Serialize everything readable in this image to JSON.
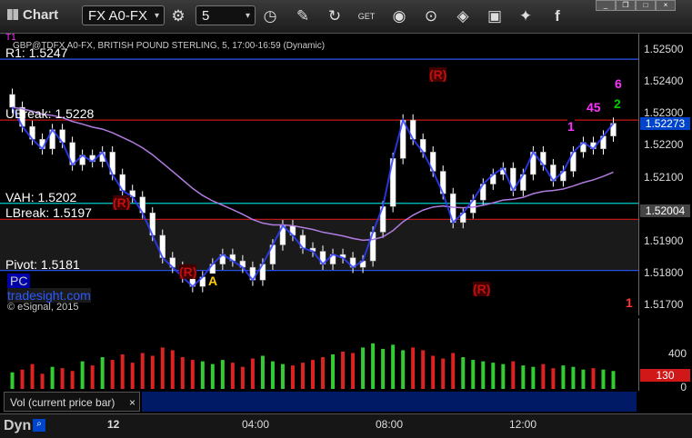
{
  "toolbar": {
    "title": "Chart",
    "symbol": "FX A0-FX",
    "interval": "5",
    "icons": [
      "clock-icon",
      "pencil-icon",
      "refresh-icon",
      "cursor-icon",
      "play-icon",
      "diamond-icon",
      "app-icon",
      "twitter-icon",
      "facebook-icon"
    ]
  },
  "chart": {
    "header": "GBP@TDFX A0-FX, BRITISH POUND STERLING, 5, 17:00-16:59 (Dynamic)",
    "corner_label": "T1",
    "copyright": "© eSignal, 2015",
    "watermark": "tradesight.com",
    "pc_label": "PC",
    "levels": [
      {
        "label": "R1: 1.5247",
        "value": 1.5247,
        "color": "#2d58ff"
      },
      {
        "label": "UBreak: 1.5228",
        "value": 1.5228,
        "color": "#d01818"
      },
      {
        "label": "VAH: 1.5202",
        "value": 1.5202,
        "color": "#00cccc"
      },
      {
        "label": "LBreak: 1.5197",
        "value": 1.5197,
        "color": "#d01818"
      },
      {
        "label": "Pivot: 1.5181",
        "value": 1.5181,
        "color": "#2d58ff"
      }
    ],
    "markers": [
      {
        "text": "(R)",
        "color": "#c01010",
        "bg": "#400000"
      },
      {
        "text": "(R)",
        "color": "#c01010",
        "bg": "#400000"
      },
      {
        "text": "(R)",
        "color": "#c01010",
        "bg": "#400000"
      },
      {
        "text": "(R)",
        "color": "#c01010",
        "bg": "#400000"
      },
      {
        "text": "A",
        "color": "#ffcc00",
        "bg": "#000"
      },
      {
        "text": "1",
        "color": "#ff3333",
        "bg": "#000"
      },
      {
        "text": "1",
        "color": "#ff33ff",
        "bg": "#000"
      },
      {
        "text": "6",
        "color": "#ff33ff",
        "bg": "#000"
      },
      {
        "text": "45",
        "color": "#ff33ff",
        "bg": "#000"
      },
      {
        "text": "2",
        "color": "#00cc00",
        "bg": "#000"
      }
    ],
    "price_axis": {
      "ticks": [
        "1.52500",
        "1.52400",
        "1.52300",
        "1.52200",
        "1.52100",
        "1.52000",
        "1.51900",
        "1.51800",
        "1.51700"
      ],
      "last_price": "1.52273",
      "vah_price": "1.52004"
    },
    "time_axis": {
      "labels": [
        "12",
        "04:00",
        "08:00",
        "12:00"
      ]
    }
  },
  "chart_data": {
    "type": "candlestick",
    "title": "GBP@TDFX A0-FX, BRITISH POUND STERLING, 5, 17:00-16:59 (Dynamic)",
    "ylim": [
      1.5167,
      1.5255
    ],
    "x": [
      "12",
      "04:00",
      "08:00",
      "12:00"
    ],
    "close": [
      1.5232,
      1.5226,
      1.5222,
      1.5219,
      1.5225,
      1.5221,
      1.5214,
      1.5217,
      1.5215,
      1.5218,
      1.5211,
      1.5206,
      1.5204,
      1.5199,
      1.5192,
      1.5185,
      1.5182,
      1.5179,
      1.5176,
      1.5179,
      1.5183,
      1.5186,
      1.5184,
      1.5182,
      1.5178,
      1.5183,
      1.5189,
      1.5195,
      1.5192,
      1.5188,
      1.5187,
      1.5183,
      1.5186,
      1.5185,
      1.5182,
      1.5184,
      1.5193,
      1.5201,
      1.5216,
      1.5228,
      1.5222,
      1.5218,
      1.5212,
      1.5205,
      1.5196,
      1.5199,
      1.5203,
      1.5208,
      1.5211,
      1.5213,
      1.5206,
      1.5211,
      1.5218,
      1.5214,
      1.5209,
      1.5212,
      1.5218,
      1.5221,
      1.5219,
      1.5223,
      1.5227
    ],
    "volume": {
      "name": "Vol (current price bar)",
      "axis_ticks": [
        "400",
        "0"
      ],
      "last": "130",
      "values": [
        120,
        140,
        180,
        110,
        160,
        150,
        130,
        200,
        170,
        230,
        210,
        250,
        190,
        260,
        240,
        300,
        280,
        230,
        210,
        200,
        180,
        210,
        190,
        160,
        220,
        240,
        200,
        180,
        170,
        190,
        210,
        230,
        250,
        270,
        260,
        300,
        330,
        290,
        320,
        280,
        300,
        280,
        240,
        220,
        260,
        230,
        210,
        200,
        190,
        180,
        200,
        170,
        160,
        180,
        150,
        170,
        160,
        140,
        150,
        140,
        130
      ]
    },
    "indicators": [
      {
        "name": "VWAP-like average",
        "color": "#b07ce0"
      },
      {
        "name": "Short average",
        "color": "#2d3dff"
      }
    ]
  }
}
